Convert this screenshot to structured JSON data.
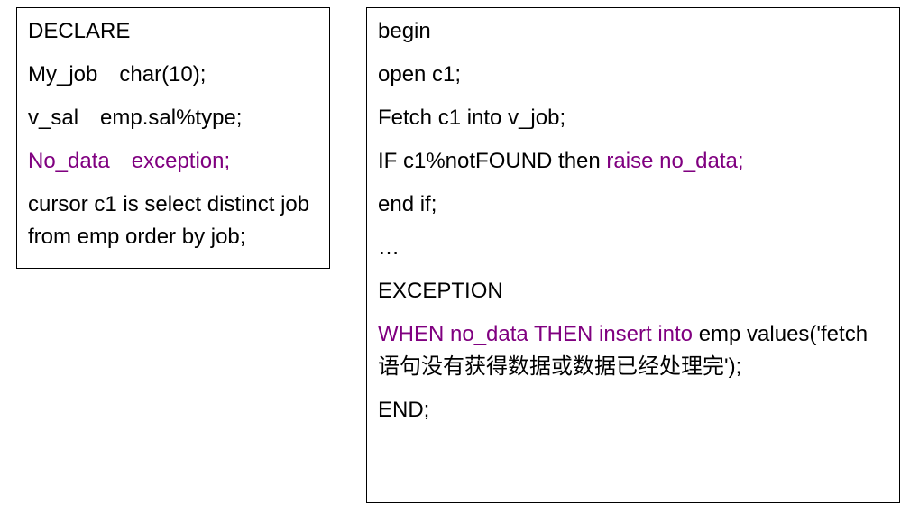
{
  "left": {
    "l1": "DECLARE",
    "l2a": "My_job",
    "l2b": "char(10);",
    "l3a": "v_sal",
    "l3b": "emp.sal%type;",
    "l4a": "No_data",
    "l4b": "exception;",
    "l5": "cursor c1 is select distinct job from emp    order by job;"
  },
  "right": {
    "r1": "begin",
    "r2": "open c1;",
    "r3": "Fetch c1 into v_job;",
    "r4a": "IF c1%notFOUND then ",
    "r4b": "raise no_data;",
    "r5": "end if;",
    "r6": "…",
    "r7": "EXCEPTION",
    "r8a": "WHEN no_data  THEN insert into",
    "r8b": " emp values('fetch语句没有获得数据或数据已经处理完');",
    "r9": "END;"
  }
}
